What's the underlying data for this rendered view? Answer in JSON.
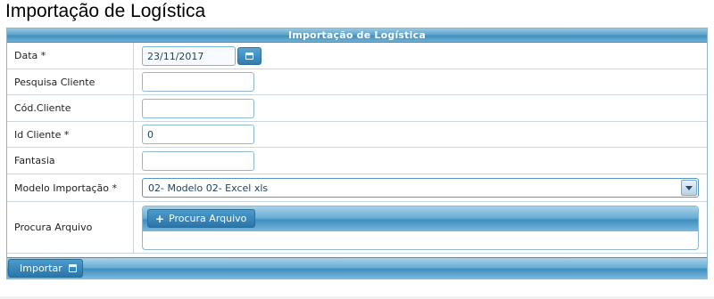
{
  "page": {
    "title": "Importação de Logística"
  },
  "panel": {
    "header": "Importação de Logística"
  },
  "fields": {
    "data": {
      "label": "Data *",
      "value": "23/11/2017"
    },
    "pesquisa_cliente": {
      "label": "Pesquisa Cliente",
      "value": ""
    },
    "cod_cliente": {
      "label": "Cód.Cliente",
      "value": ""
    },
    "id_cliente": {
      "label": "Id Cliente *",
      "value": "0"
    },
    "fantasia": {
      "label": "Fantasia",
      "value": ""
    },
    "modelo_importacao": {
      "label": "Modelo Importação  *",
      "value": "02- Modelo 02- Excel xls"
    },
    "procura_arquivo": {
      "label": "Procura Arquivo",
      "button_label": "Procura Arquivo"
    }
  },
  "footer": {
    "import_label": "Importar"
  },
  "icons": {
    "calendar": "calendar-icon",
    "dropdown": "chevron-down-icon",
    "plus": "plus-icon",
    "save": "save-icon"
  },
  "colors": {
    "accent": "#3f8fc0",
    "header_text": "#ffffff"
  }
}
